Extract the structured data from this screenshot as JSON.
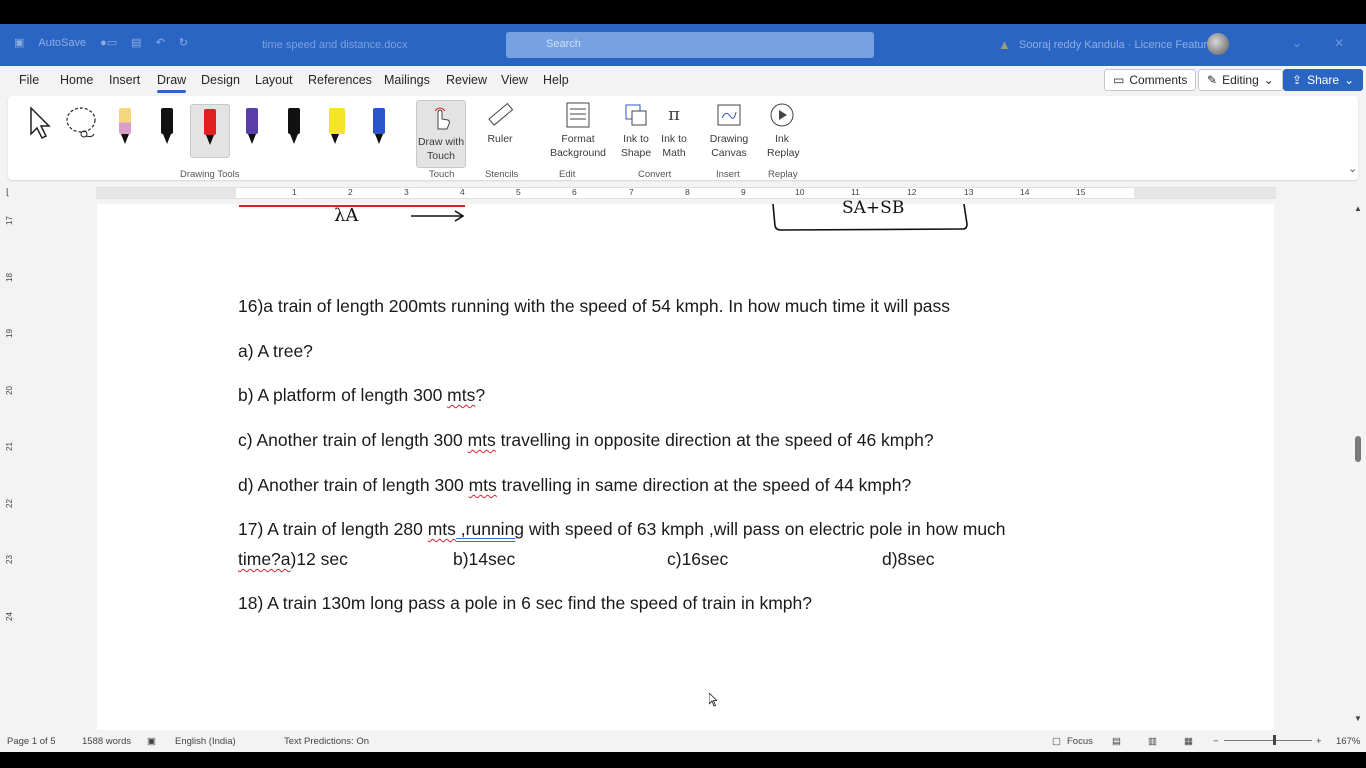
{
  "titlebar": {
    "autosave": "AutoSave",
    "doc_title": "time speed and distance.docx",
    "search_placeholder": "Search",
    "user_name": "Sooraj reddy Kandula · Licence Features",
    "warning_icon": "warning-icon"
  },
  "menu": {
    "tabs": [
      "File",
      "Home",
      "Insert",
      "Draw",
      "Design",
      "Layout",
      "References",
      "Mailings",
      "Review",
      "View",
      "Help"
    ],
    "active_tab": "Draw",
    "comments": "Comments",
    "editing": "Editing",
    "share": "Share"
  },
  "ribbon": {
    "pens": [
      {
        "name": "pen-highlighter-yellow",
        "color": "#f4d77c"
      },
      {
        "name": "pen-black",
        "color": "#111111"
      },
      {
        "name": "pen-red",
        "color": "#e02020"
      },
      {
        "name": "pen-purple",
        "color": "#5a3ea8"
      },
      {
        "name": "pen-black-2",
        "color": "#111111"
      },
      {
        "name": "highlighter-yellow",
        "color": "#f5e42a"
      },
      {
        "name": "pen-galaxy",
        "color": "#2a56c8"
      }
    ],
    "draw_with_touch": "Draw with Touch",
    "ruler": "Ruler",
    "format_background": "Format Background",
    "ink_to_shape": "Ink to Shape",
    "ink_to_math": "Ink to Math",
    "drawing_canvas": "Drawing Canvas",
    "ink_replay": "Ink Replay",
    "groups": {
      "drawing_tools": "Drawing Tools",
      "touch": "Touch",
      "stencils": "Stencils",
      "edit": "Edit",
      "convert": "Convert",
      "insert": "Insert",
      "replay": "Replay"
    }
  },
  "ruler_numbers": [
    "1",
    "2",
    "3",
    "4",
    "5",
    "6",
    "7",
    "8",
    "9",
    "10",
    "11",
    "12",
    "13",
    "14",
    "15"
  ],
  "vruler_numbers": [
    "17",
    "18",
    "19",
    "20",
    "21",
    "22",
    "23",
    "24"
  ],
  "document": {
    "ink_label_left": "λA",
    "ink_label_right": "SA+SB",
    "q16": "16)a train of length 200mts running with the speed of 54 kmph. In how much time it will pass",
    "q16a": "a) A tree?",
    "q16b_pre": "b) A platform of length 300 ",
    "q16b_sq": "mts",
    "q16b_post": "?",
    "q16c_pre": "c) Another train of length 300 ",
    "q16c_sq": "mts",
    "q16c_post": " travelling in opposite direction at the speed of 46 kmph?",
    "q16d_pre": "d) Another train of length 300 ",
    "q16d_sq": "mts",
    "q16d_post": " travelling in same direction at the speed of 44 kmph?",
    "q17_pre": "17) A train of length 280 ",
    "q17_sq": "mts",
    "q17_blue": " ,running",
    "q17_post": " with speed of 63 kmph ,will pass on electric pole in how much",
    "q17_l2_sq": "time?a",
    "q17_l2_a": ")12 sec",
    "q17_b": "b)14sec",
    "q17_c": "c)16sec",
    "q17_d": "d)8sec",
    "q18": "18)  A train 130m long pass a pole in 6 sec find the speed of train in kmph?"
  },
  "status": {
    "page": "Page 1 of 5",
    "words": "1588 words",
    "language": "English (India)",
    "predictions": "Text Predictions: On",
    "focus": "Focus",
    "zoom": "167%"
  }
}
